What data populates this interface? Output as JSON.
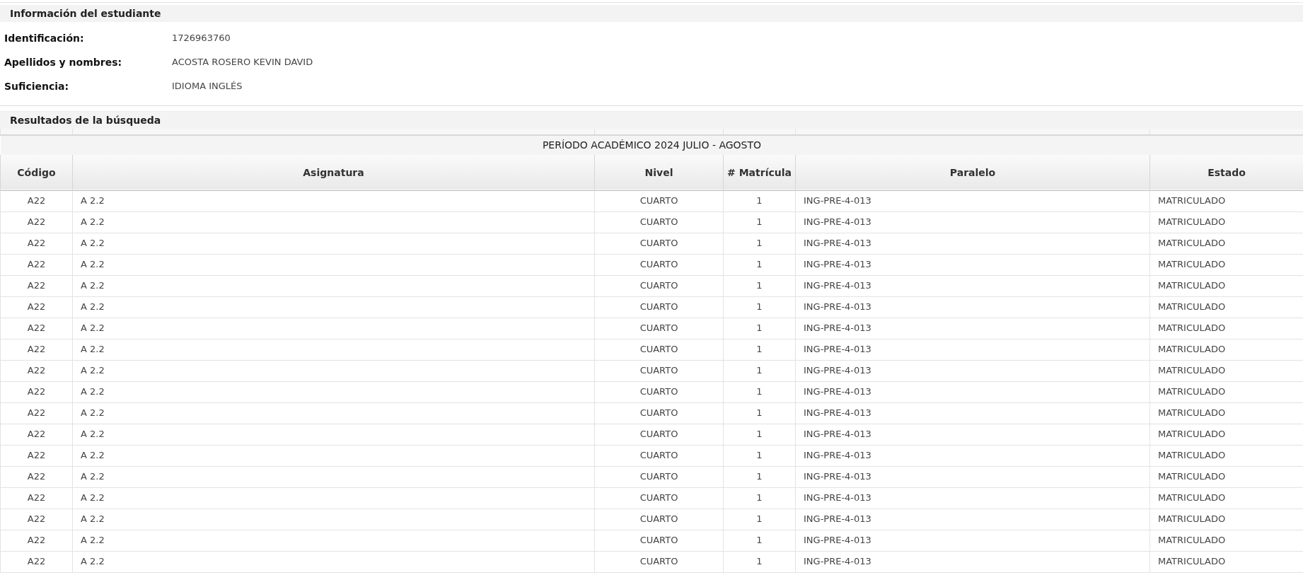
{
  "student_info": {
    "title": "Información del estudiante",
    "fields": [
      {
        "label": "Identificación:",
        "value": "1726963760"
      },
      {
        "label": "Apellidos y nombres:",
        "value": "ACOSTA ROSERO KEVIN DAVID"
      },
      {
        "label": "Suficiencia:",
        "value": "IDIOMA INGLÉS"
      }
    ]
  },
  "results": {
    "title": "Resultados de la búsqueda",
    "period": "PERÍODO ACADÉMICO 2024 JULIO - AGOSTO",
    "columns": [
      "Código",
      "Asignatura",
      "Nivel",
      "# Matrícula",
      "Paralelo",
      "Estado"
    ],
    "rows": [
      [
        "A22",
        "A 2.2",
        "CUARTO",
        "1",
        "ING-PRE-4-013",
        "MATRICULADO"
      ],
      [
        "A22",
        "A 2.2",
        "CUARTO",
        "1",
        "ING-PRE-4-013",
        "MATRICULADO"
      ],
      [
        "A22",
        "A 2.2",
        "CUARTO",
        "1",
        "ING-PRE-4-013",
        "MATRICULADO"
      ],
      [
        "A22",
        "A 2.2",
        "CUARTO",
        "1",
        "ING-PRE-4-013",
        "MATRICULADO"
      ],
      [
        "A22",
        "A 2.2",
        "CUARTO",
        "1",
        "ING-PRE-4-013",
        "MATRICULADO"
      ],
      [
        "A22",
        "A 2.2",
        "CUARTO",
        "1",
        "ING-PRE-4-013",
        "MATRICULADO"
      ],
      [
        "A22",
        "A 2.2",
        "CUARTO",
        "1",
        "ING-PRE-4-013",
        "MATRICULADO"
      ],
      [
        "A22",
        "A 2.2",
        "CUARTO",
        "1",
        "ING-PRE-4-013",
        "MATRICULADO"
      ],
      [
        "A22",
        "A 2.2",
        "CUARTO",
        "1",
        "ING-PRE-4-013",
        "MATRICULADO"
      ],
      [
        "A22",
        "A 2.2",
        "CUARTO",
        "1",
        "ING-PRE-4-013",
        "MATRICULADO"
      ],
      [
        "A22",
        "A 2.2",
        "CUARTO",
        "1",
        "ING-PRE-4-013",
        "MATRICULADO"
      ],
      [
        "A22",
        "A 2.2",
        "CUARTO",
        "1",
        "ING-PRE-4-013",
        "MATRICULADO"
      ],
      [
        "A22",
        "A 2.2",
        "CUARTO",
        "1",
        "ING-PRE-4-013",
        "MATRICULADO"
      ],
      [
        "A22",
        "A 2.2",
        "CUARTO",
        "1",
        "ING-PRE-4-013",
        "MATRICULADO"
      ],
      [
        "A22",
        "A 2.2",
        "CUARTO",
        "1",
        "ING-PRE-4-013",
        "MATRICULADO"
      ],
      [
        "A22",
        "A 2.2",
        "CUARTO",
        "1",
        "ING-PRE-4-013",
        "MATRICULADO"
      ],
      [
        "A22",
        "A 2.2",
        "CUARTO",
        "1",
        "ING-PRE-4-013",
        "MATRICULADO"
      ],
      [
        "A22",
        "A 2.2",
        "CUARTO",
        "1",
        "ING-PRE-4-013",
        "MATRICULADO"
      ]
    ]
  }
}
